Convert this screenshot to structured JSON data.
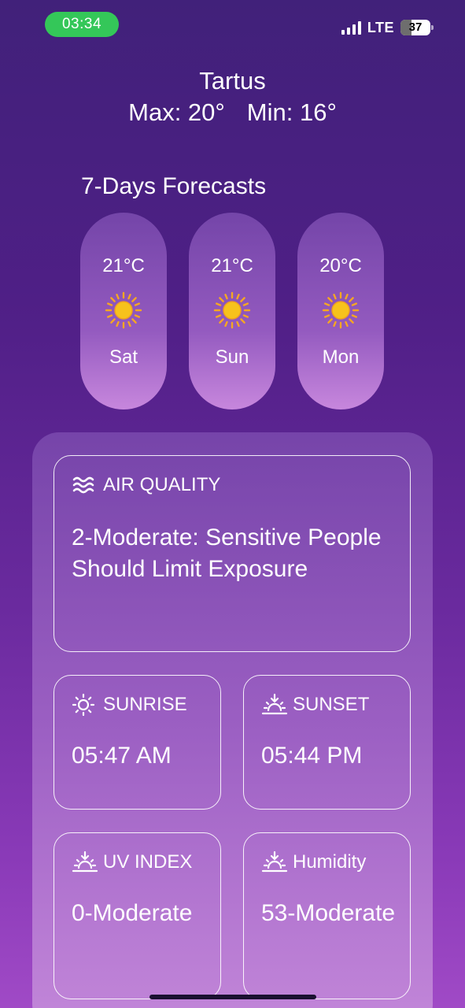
{
  "status_bar": {
    "time": "03:34",
    "network": "LTE",
    "battery": "37",
    "battery_level": 0.37
  },
  "header": {
    "city": "Tartus",
    "max": "Max: 20°",
    "min": "Min: 16°"
  },
  "forecast": {
    "title": "7-Days Forecasts",
    "days": [
      {
        "temp": "21°C",
        "day": "Sat",
        "icon": "sun-icon"
      },
      {
        "temp": "21°C",
        "day": "Sun",
        "icon": "sun-icon"
      },
      {
        "temp": "20°C",
        "day": "Mon",
        "icon": "sun-icon"
      }
    ]
  },
  "details": {
    "air_quality": {
      "label": "AIR QUALITY",
      "value": "2-Moderate: Sensitive People Should Limit Exposure",
      "icon": "wind-waves-icon"
    },
    "sunrise": {
      "label": "SUNRISE",
      "value": "05:47 AM",
      "icon": "sunrise-icon"
    },
    "sunset": {
      "label": "SUNSET",
      "value": "05:44 PM",
      "icon": "sunset-icon"
    },
    "uv_index": {
      "label": "UV INDEX",
      "value": "0-Moderate",
      "icon": "sunset-icon"
    },
    "humidity": {
      "label": "Humidity",
      "value": "53-Moderate",
      "icon": "sunset-icon"
    }
  },
  "colors": {
    "status_pill": "#34c759",
    "background_top": "#41217a",
    "background_bottom": "#a04ac6",
    "sun": "#f7c21c"
  }
}
